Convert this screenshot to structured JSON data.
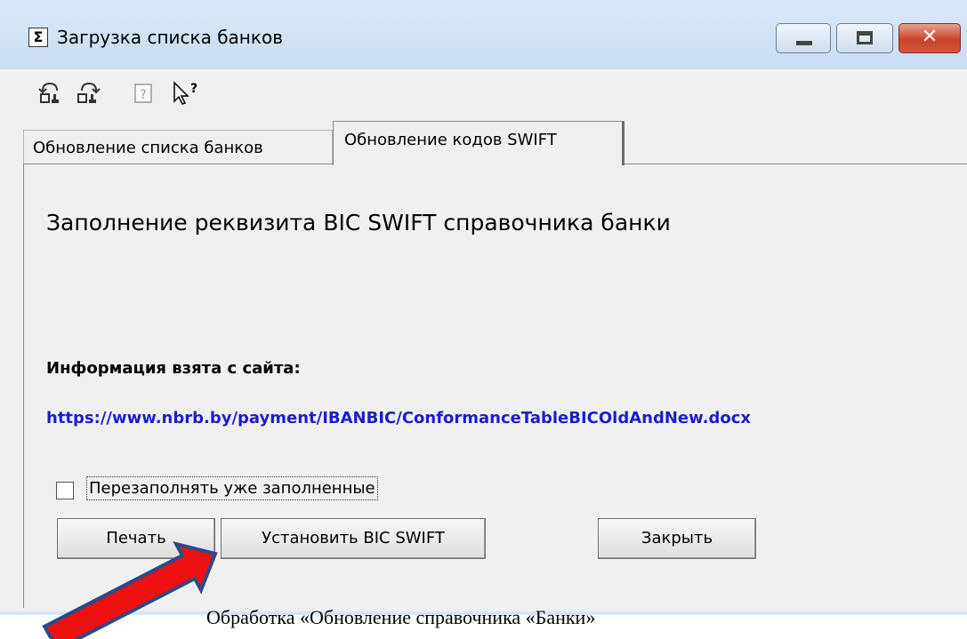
{
  "window": {
    "icon_glyph": "Σ",
    "title": "Загрузка списка банков",
    "close_glyph": "✕"
  },
  "toolbar": {
    "icons": [
      "undo-icon",
      "redo-icon",
      "help-icon",
      "context-help-icon"
    ]
  },
  "tabs": [
    {
      "label": "Обновление списка банков"
    },
    {
      "label": "Обновление кодов SWIFT"
    }
  ],
  "panel": {
    "title": "Заполнение реквизита BIC SWIFT справочника банки",
    "info_label": "Информация взята с сайта:",
    "link": "https://www.nbrb.by/payment/IBANBIC/ConformanceTableBICOldAndNew.docx",
    "checkbox_label": "Перезаполнять уже заполненные",
    "checkbox_checked": false
  },
  "buttons": {
    "print": "Печать",
    "set_bic": "Установить BIC SWIFT",
    "close": "Закрыть"
  },
  "caption": "Обработка «Обновление справочника «Банки»",
  "colors": {
    "link": "#1c1ccf",
    "arrow_fill": "#ee1111",
    "arrow_stroke": "#2a4a8a"
  }
}
